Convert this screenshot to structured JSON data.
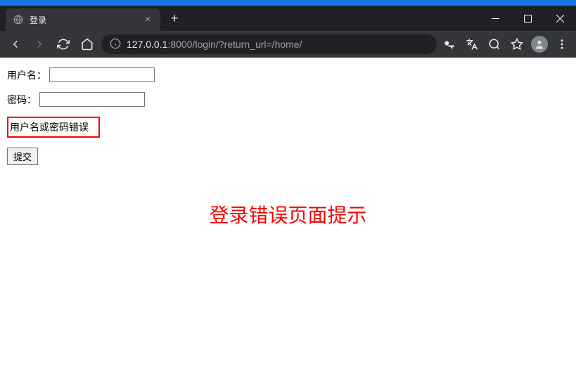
{
  "browser": {
    "tab_title": "登录",
    "url_host": "127.0.0.1",
    "url_port": ":8000",
    "url_path": "/login/?return_url=/home/"
  },
  "form": {
    "username_label": "用户名：",
    "password_label": "密码：",
    "error_message": "用户名或密码错误",
    "submit_label": "提交"
  },
  "annotation": {
    "text": "登录错误页面提示"
  }
}
